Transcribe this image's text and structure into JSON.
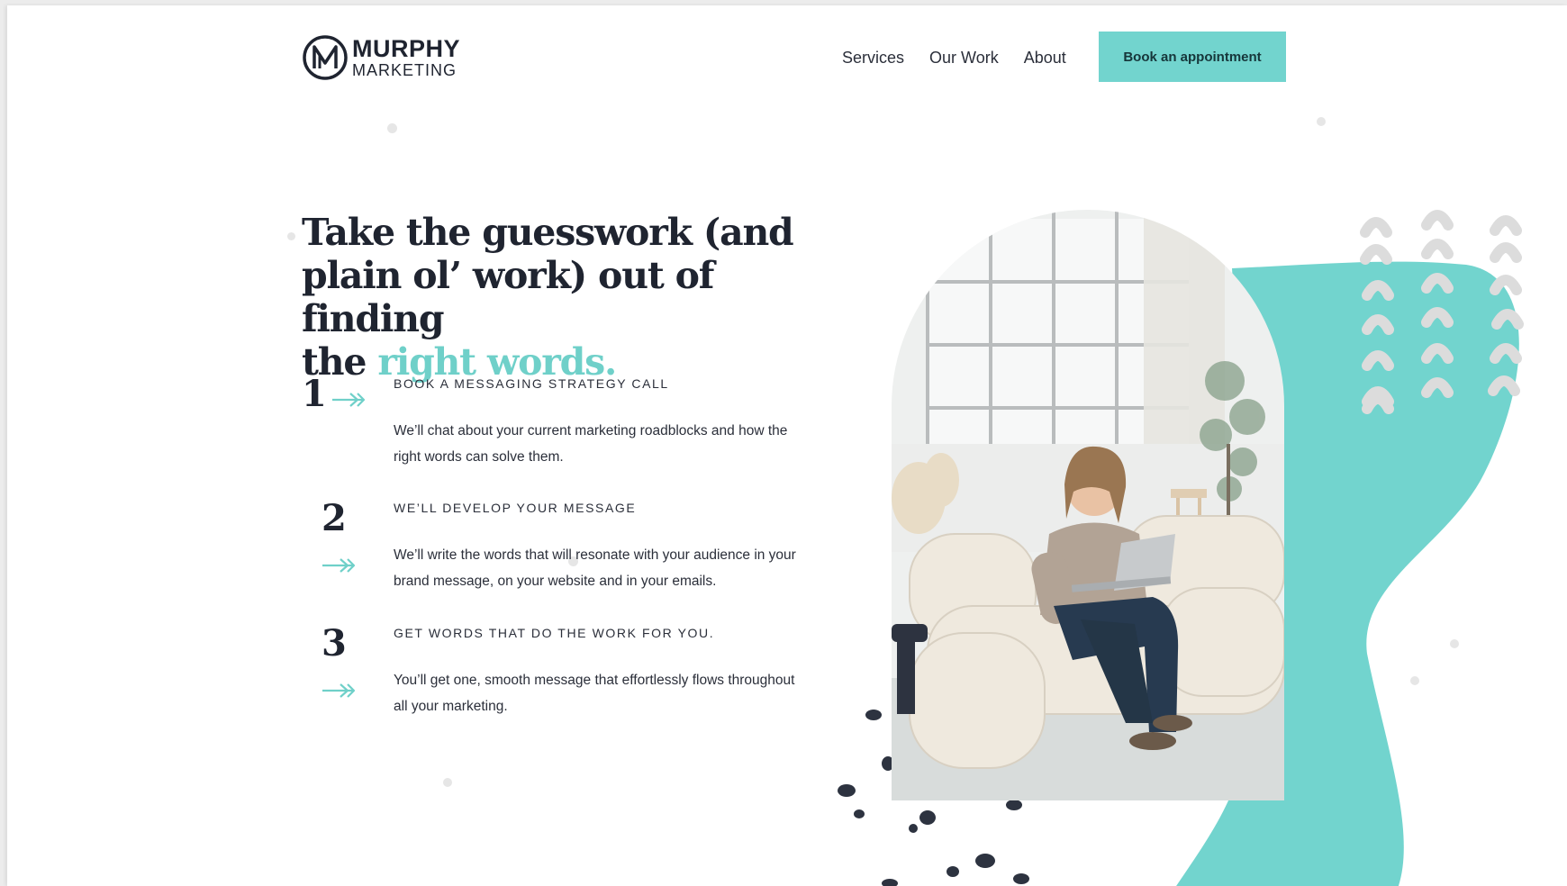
{
  "brand": {
    "name": "MURPHY",
    "sub": "MARKETING",
    "accent_color": "#72d4ce",
    "dark_color": "#1f2430"
  },
  "nav": {
    "items": [
      "Services",
      "Our Work",
      "About"
    ],
    "cta": "Book an appointment"
  },
  "hero": {
    "headline_line1": "Take the guesswork (and",
    "headline_line2": "plain ol’ work) out of finding",
    "headline_line3_prefix": "the",
    "headline_accent": "right words."
  },
  "steps": [
    {
      "number": "1",
      "title": "BOOK A MESSAGING STRATEGY CALL",
      "body": "We’ll chat about your current marketing roadblocks and how the right words can solve them."
    },
    {
      "number": "2",
      "title": "WE’LL DEVELOP YOUR MESSAGE",
      "body": "We’ll write the words that will resonate with your audience in your brand message, on your website and in your emails."
    },
    {
      "number": "3",
      "title": "GET WORDS THAT DO THE WORK FOR YOU.",
      "body": "You’ll get one, smooth message that effortlessly flows throughout all your marketing."
    }
  ],
  "icons": {
    "logo": "m-monogram-icon",
    "step_arrow": "double-arrow-right-icon"
  }
}
